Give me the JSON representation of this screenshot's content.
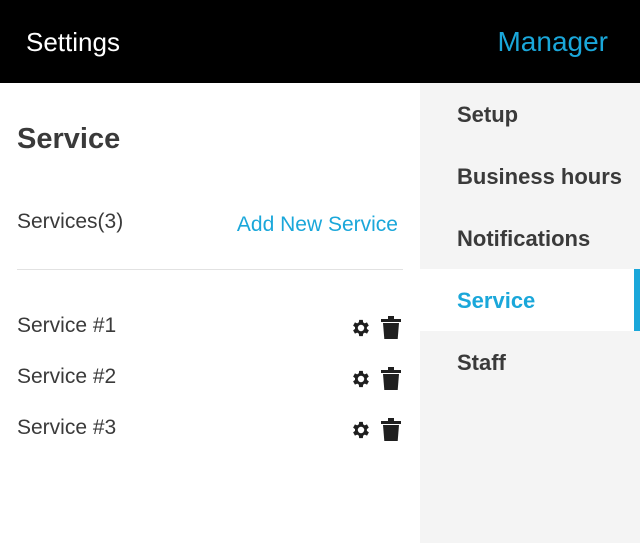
{
  "header": {
    "title": "Settings",
    "manager_label": "Manager"
  },
  "main": {
    "page_title": "Service",
    "services_count_label": "Services(3)",
    "add_service_label": "Add New Service",
    "services": [
      {
        "name": "Service #1"
      },
      {
        "name": "Service #2"
      },
      {
        "name": "Service #3"
      }
    ]
  },
  "sidebar": {
    "items": [
      {
        "label": "Setup",
        "active": false
      },
      {
        "label": "Business hours",
        "active": false
      },
      {
        "label": "Notifications",
        "active": false
      },
      {
        "label": "Service",
        "active": true
      },
      {
        "label": "Staff",
        "active": false
      }
    ]
  },
  "icons": {
    "settings": "gear-icon",
    "delete": "trash-icon"
  },
  "colors": {
    "accent": "#1aa7da",
    "header_bg": "#000000",
    "sidebar_bg": "#f4f4f4",
    "text": "#3a3a3a"
  }
}
